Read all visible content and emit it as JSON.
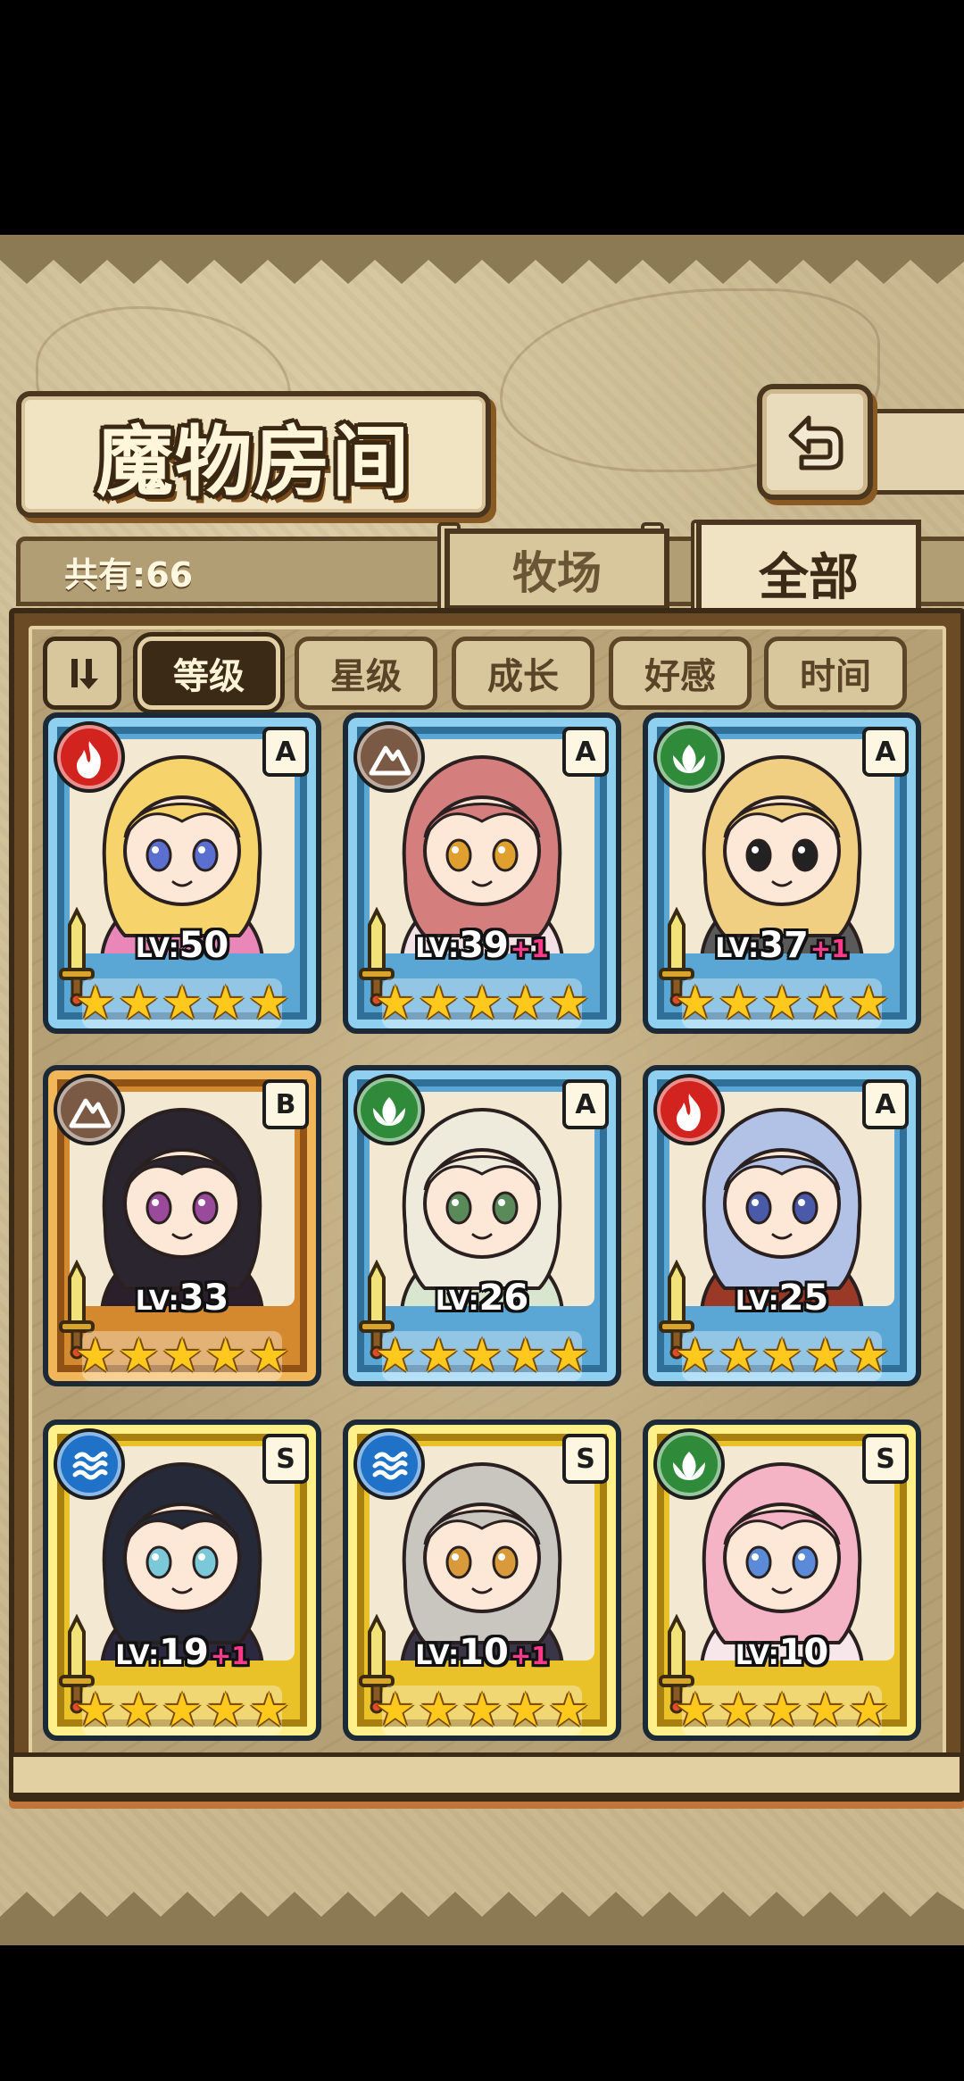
{
  "title": "魔物房间",
  "total_count": "共有:66",
  "tabs": [
    {
      "label": "牧场",
      "active": false
    },
    {
      "label": "全部",
      "active": true
    }
  ],
  "sort_buttons": [
    {
      "label": "等级",
      "active": true
    },
    {
      "label": "星级",
      "active": false
    },
    {
      "label": "成长",
      "active": false
    },
    {
      "label": "好感",
      "active": false
    },
    {
      "label": "时间",
      "active": false
    }
  ],
  "icons": {
    "back": "return-arrow-icon",
    "sort_toggle": "sort-order-icon",
    "elements": [
      "fire-element-icon",
      "earth-element-icon",
      "wind-element-icon",
      "water-element-icon"
    ]
  },
  "colors": {
    "rank_A": "#5aa7d6",
    "rank_B": "#d4892e",
    "rank_S": "#e9c22a",
    "fire": "#d3231f",
    "earth": "#7b5a45",
    "wind": "#2f8a3a",
    "water": "#1f72c8"
  },
  "monsters": [
    {
      "element": "fire",
      "rank": "A",
      "level": "50",
      "bonus": "",
      "stars": 5,
      "hair": "#f6d36b",
      "outfit": "#e887b8",
      "eyes": "#5b6fd0"
    },
    {
      "element": "earth",
      "rank": "A",
      "level": "39",
      "bonus": "+1",
      "stars": 5,
      "hair": "#d47f7e",
      "outfit": "#f3e1e6",
      "eyes": "#e0a030"
    },
    {
      "element": "wind",
      "rank": "A",
      "level": "37",
      "bonus": "+1",
      "stars": 5,
      "hair": "#f0cf83",
      "outfit": "#5a5a5a",
      "eyes": "#222222"
    },
    {
      "element": "earth",
      "rank": "B",
      "level": "33",
      "bonus": "",
      "stars": 5,
      "hair": "#2b2530",
      "outfit": "#2a1f2a",
      "eyes": "#9a4a9a"
    },
    {
      "element": "wind",
      "rank": "A",
      "level": "26",
      "bonus": "",
      "stars": 5,
      "hair": "#eeeadc",
      "outfit": "#d9e6cf",
      "eyes": "#5a8a5a"
    },
    {
      "element": "fire",
      "rank": "A",
      "level": "25",
      "bonus": "",
      "stars": 5,
      "hair": "#b2c2e6",
      "outfit": "#9a3a26",
      "eyes": "#4a5aa8"
    },
    {
      "element": "water",
      "rank": "S",
      "level": "19",
      "bonus": "+1",
      "stars": 5,
      "hair": "#262a38",
      "outfit": "#2c2840",
      "eyes": "#7ac8d8"
    },
    {
      "element": "water",
      "rank": "S",
      "level": "10",
      "bonus": "+1",
      "stars": 5,
      "hair": "#c9c6bf",
      "outfit": "#3a3648",
      "eyes": "#d89a3a"
    },
    {
      "element": "wind",
      "rank": "S",
      "level": "10",
      "bonus": "",
      "stars": 5,
      "hair": "#f4b4c6",
      "outfit": "#f7e6ea",
      "eyes": "#5a8ad8"
    }
  ]
}
